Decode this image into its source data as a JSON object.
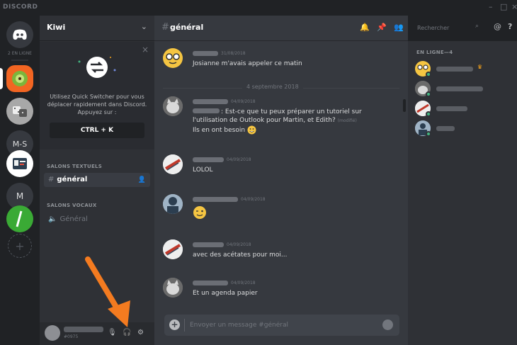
{
  "titlebar": {
    "brand": "DISCORD",
    "minimize": "–",
    "maximize": "□",
    "close": "×"
  },
  "rail": {
    "online_label": "2 EN LIGNE",
    "initials_1": "M-S",
    "initials_2": "M",
    "add": "+"
  },
  "sidebar": {
    "server_name": "Kiwi",
    "quick_switcher": {
      "text": "Utilisez Quick Switcher pour vous déplacer rapidement dans Discord. Appuyez sur :",
      "shortcut": "CTRL + K",
      "close": "×"
    },
    "text_category": "SALONS TEXTUELS",
    "text_channel": "général",
    "voice_category": "SALONS VOCAUX",
    "voice_channel": "Général",
    "user": {
      "discriminator": "#0975"
    }
  },
  "chat": {
    "channel": "général",
    "messages": [
      {
        "time": "31/08/2018",
        "text": "Josianne m'avais appeler ce matin"
      },
      {
        "time": "04/09/2018",
        "text": ": Est-ce que tu peux préparer un tutoriel sur l'utilisation de Outlook pour Martin, et Edith?",
        "edited": "(modifié)",
        "text2": "Ils en ont besoin"
      },
      {
        "time": "04/09/2018",
        "text": "LOLOL"
      },
      {
        "time": "04/09/2018",
        "text": ""
      },
      {
        "time": "04/09/2018",
        "text": "avec des acétates pour moi..."
      },
      {
        "time": "04/09/2018",
        "text": "Et un agenda papier"
      }
    ],
    "date_divider": "4 septembre 2018",
    "composer_placeholder": "Envoyer un message #général"
  },
  "header": {
    "search_placeholder": "Rechercher",
    "help": "?",
    "mention": "@"
  },
  "members": {
    "header": "EN LIGNE—4"
  },
  "colors": {
    "accent": "#7289da",
    "online": "#43b581",
    "arrow": "#f47b20"
  }
}
